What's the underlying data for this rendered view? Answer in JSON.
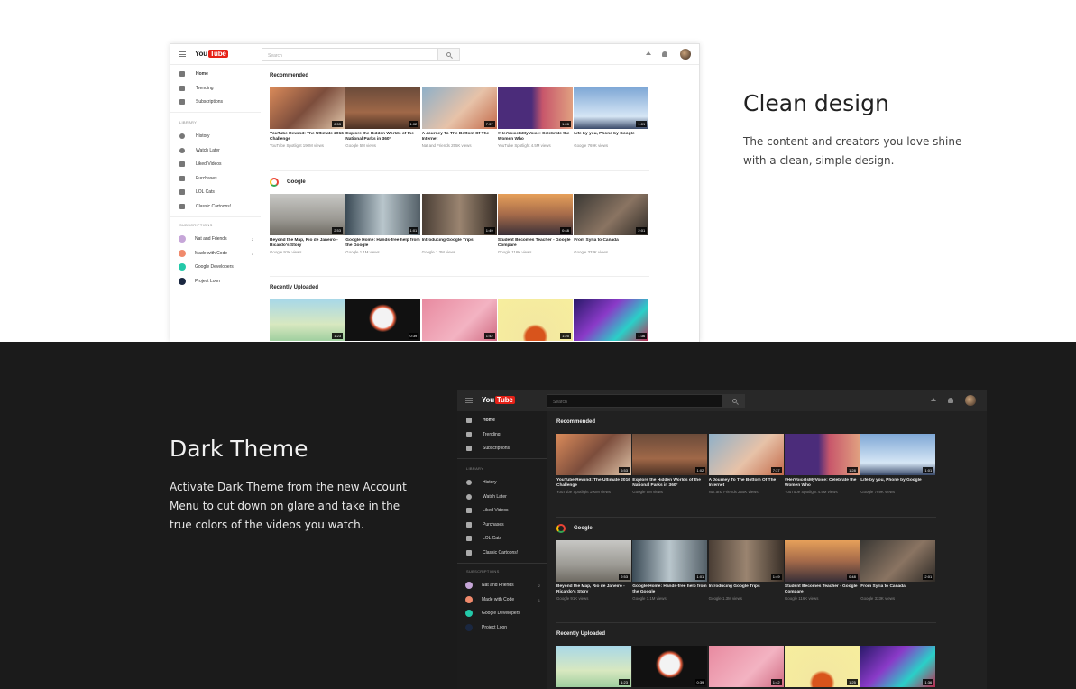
{
  "features": {
    "light": {
      "title": "Clean design",
      "text": "The content and creators you love shine with a clean, simple design."
    },
    "dark": {
      "title": "Dark Theme",
      "text": "Activate Dark Theme from the new Account Menu to cut down on glare and take in the true colors of the videos you watch."
    }
  },
  "yt": {
    "logo_you": "You",
    "logo_tube": "Tube",
    "search_placeholder": "Search",
    "sidebar": {
      "main": [
        "Home",
        "Trending",
        "Subscriptions"
      ],
      "library_heading": "LIBRARY",
      "library": [
        "History",
        "Watch Later",
        "Liked Videos",
        "Purchases",
        "LOL Cats",
        "Classic Cartoons!"
      ],
      "subscriptions_heading": "SUBSCRIPTIONS",
      "subscriptions": [
        {
          "name": "Nat and Friends",
          "count": "2",
          "color": "#c6a6d8"
        },
        {
          "name": "Made with Code",
          "count": "1",
          "color": "#f08a6c"
        },
        {
          "name": "Google Developers",
          "count": "",
          "color": "#23c9a9"
        },
        {
          "name": "Project Loon",
          "count": "",
          "color": "#1a2740"
        }
      ]
    },
    "shelves": [
      {
        "title": "Recommended",
        "videos": [
          {
            "title": "YouTube Rewind: The Ultimate 2016 Challenge",
            "channel": "YouTube Spotlight",
            "views": "190M views",
            "duration": "6:53",
            "bg": "linear-gradient(135deg,#d98a5a,#7c4d3c 50%,#e0c4a8)"
          },
          {
            "title": "Explore the Hidden Worlds of the National Parks in 360°",
            "channel": "Google",
            "views": "5M views",
            "duration": "1:02",
            "bg": "linear-gradient(180deg,#6b4b3a,#a06848 60%,#4a3024)"
          },
          {
            "title": "A Journey To The Bottom Of The Internet",
            "channel": "Nat and Friends",
            "views": "255K views",
            "duration": "7:37",
            "bg": "linear-gradient(135deg,#8fb0c8,#e7c2a8 55%,#c36a4a)"
          },
          {
            "title": "#HerVoiceIsMyVoice: Celebrate the Women Who",
            "channel": "YouTube Spotlight",
            "views": "4.5M views",
            "duration": "1:28",
            "bg": "linear-gradient(90deg,#4b2c7a 45%,#c8576b 60%,#e0a080)"
          },
          {
            "title": "Life by you, Phone by Google",
            "channel": "Google",
            "views": "769K views",
            "duration": "1:01",
            "bg": "linear-gradient(180deg,#7fa8d6,#d6e6f5 70%,#3a4a6a)"
          }
        ]
      },
      {
        "title": "Google",
        "videos": [
          {
            "title": "Beyond the Map, Rio de Janeiro - Ricardo's Story",
            "channel": "Google",
            "views": "91K views",
            "duration": "2:53",
            "bg": "linear-gradient(180deg,#c7c7c4,#9c9a94 60%,#6e6a62)"
          },
          {
            "title": "Google Home: Hands-free help from the Google",
            "channel": "Google",
            "views": "1.1M views",
            "duration": "1:01",
            "bg": "linear-gradient(90deg,#3a4a55,#b9c6cc 50%,#546068)"
          },
          {
            "title": "Introducing Google Trips",
            "channel": "Google",
            "views": "1.3M views",
            "duration": "1:49",
            "bg": "linear-gradient(90deg,#4a3e35,#9a8470 50%,#3a3028)"
          },
          {
            "title": "Student Becomes Teacher - Google Compare",
            "channel": "Google",
            "views": "116K views",
            "duration": "0:48",
            "bg": "linear-gradient(180deg,#e6a05a,#a56a4a 50%,#3a3038)"
          },
          {
            "title": "From Syria to Canada",
            "channel": "Google",
            "views": "333K views",
            "duration": "2:01",
            "bg": "linear-gradient(135deg,#3a3834,#8a7462 55%,#2e2a26)"
          }
        ]
      },
      {
        "title": "Recently Uploaded",
        "videos": [
          {
            "duration": "1:23",
            "bg": "linear-gradient(180deg,#a8d8e8,#d8e8c0 60%,#9fcf9f)"
          },
          {
            "duration": "0:39",
            "bg": "radial-gradient(circle at 50% 45%,#f3f3f3 22%,#e45c3a 26%,#111 32%)"
          },
          {
            "duration": "1:42",
            "bg": "linear-gradient(135deg,#e88aa0,#f3b3c2 60%,#d06b82)"
          },
          {
            "duration": "1:25",
            "bg": "radial-gradient(circle at 50% 90%,#d8541c 18%,#f4e8a0 24%,#f6ee9e)"
          },
          {
            "duration": "1:36",
            "bg": "linear-gradient(135deg,#2a1a6a,#8a3ac8 40%,#2ad0c8 70%,#c02a50)"
          }
        ]
      }
    ]
  }
}
